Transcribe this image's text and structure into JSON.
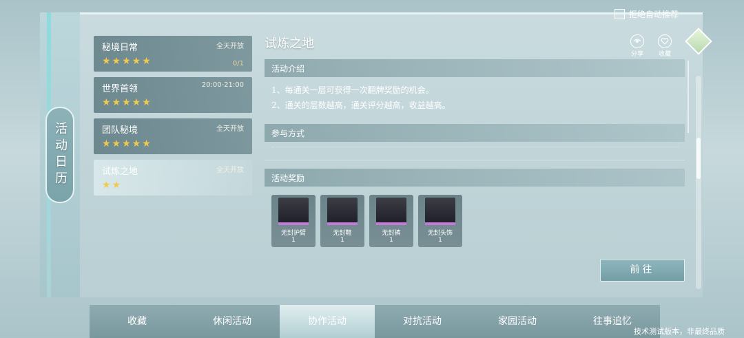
{
  "header": {
    "auto_reject_label": "拒绝自动推荐"
  },
  "calendar_tab": "活动日历",
  "activities": [
    {
      "name": "秘境日常",
      "time": "全天开放",
      "stars": "★★★★★",
      "progress": "0/1"
    },
    {
      "name": "世界首领",
      "time": "20:00-21:00",
      "stars": "★★★★★",
      "progress": ""
    },
    {
      "name": "团队秘境",
      "time": "全天开放",
      "stars": "★★★★★",
      "progress": ""
    },
    {
      "name": "试炼之地",
      "time": "全天开放",
      "stars": "★★",
      "progress": ""
    }
  ],
  "detail": {
    "title": "试炼之地",
    "share_label": "分享",
    "favorite_label": "收藏",
    "intro_header": "活动介绍",
    "intro_lines": [
      "1、每通关一层可获得一次翻牌奖励的机会。",
      "2、通关的层数越高，通关评分越高，收益越高。"
    ],
    "participation_header": "参与方式",
    "rewards_header": "活动奖励",
    "rewards": [
      {
        "name": "无封护臂",
        "count": "1"
      },
      {
        "name": "无封鞋",
        "count": "1"
      },
      {
        "name": "无封裤",
        "count": "1"
      },
      {
        "name": "无封头饰",
        "count": "1"
      }
    ],
    "go_button": "前往"
  },
  "nav_tabs": [
    {
      "label": "收藏"
    },
    {
      "label": "休闲活动"
    },
    {
      "label": "协作活动"
    },
    {
      "label": "对抗活动"
    },
    {
      "label": "家园活动"
    },
    {
      "label": "往事追忆"
    }
  ],
  "footer_note": "技术测试版本，非最终品质",
  "colors": {
    "star": "#f2c94c",
    "reward_quality": "#c27bd8"
  }
}
